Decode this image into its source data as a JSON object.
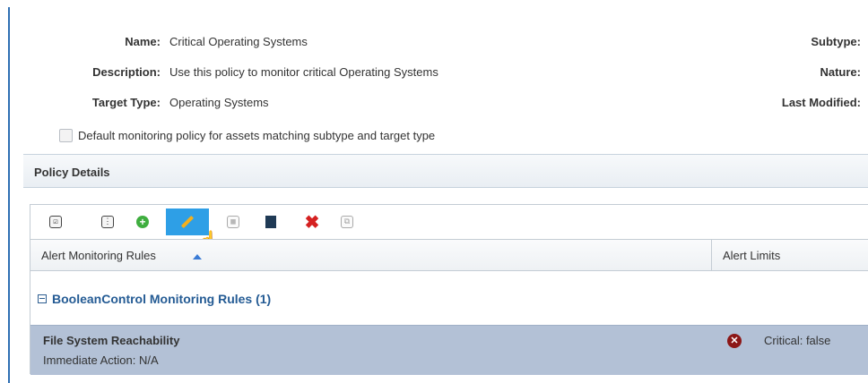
{
  "details": {
    "name_label": "Name:",
    "name_value": "Critical Operating Systems",
    "description_label": "Description:",
    "description_value": "Use this policy to monitor critical Operating Systems",
    "target_type_label": "Target Type:",
    "target_type_value": "Operating Systems",
    "subtype_label": "Subtype:",
    "nature_label": "Nature:",
    "last_modified_label": "Last Modified:",
    "default_checkbox_label": "Default monitoring policy for assets matching subtype and target type"
  },
  "section": {
    "title": "Policy Details"
  },
  "toolbar": {
    "buttons": [
      {
        "name": "select-all",
        "icon": "checklist-icon"
      },
      {
        "name": "view",
        "icon": "list-icon"
      },
      {
        "name": "add",
        "icon": "add-icon"
      },
      {
        "name": "edit",
        "icon": "pencil-icon",
        "state": "hover"
      },
      {
        "name": "move",
        "icon": "columns-icon",
        "state": "disabled"
      },
      {
        "name": "export",
        "icon": "export-icon"
      },
      {
        "name": "delete",
        "icon": "delete-icon"
      },
      {
        "name": "copy",
        "icon": "copy-icon",
        "state": "disabled"
      }
    ]
  },
  "table": {
    "columns": [
      "Alert Monitoring Rules",
      "Alert Limits"
    ],
    "group": {
      "title": "BooleanControl Monitoring Rules (1)"
    },
    "rows": [
      {
        "name": "File System Reachability",
        "action": "Immediate Action: N/A",
        "limit": "Critical: false"
      }
    ]
  },
  "colors": {
    "accent": "#2f6fb3",
    "selected_row": "#b3c1d6",
    "group_title": "#245b94",
    "critical": "#8c1717"
  }
}
